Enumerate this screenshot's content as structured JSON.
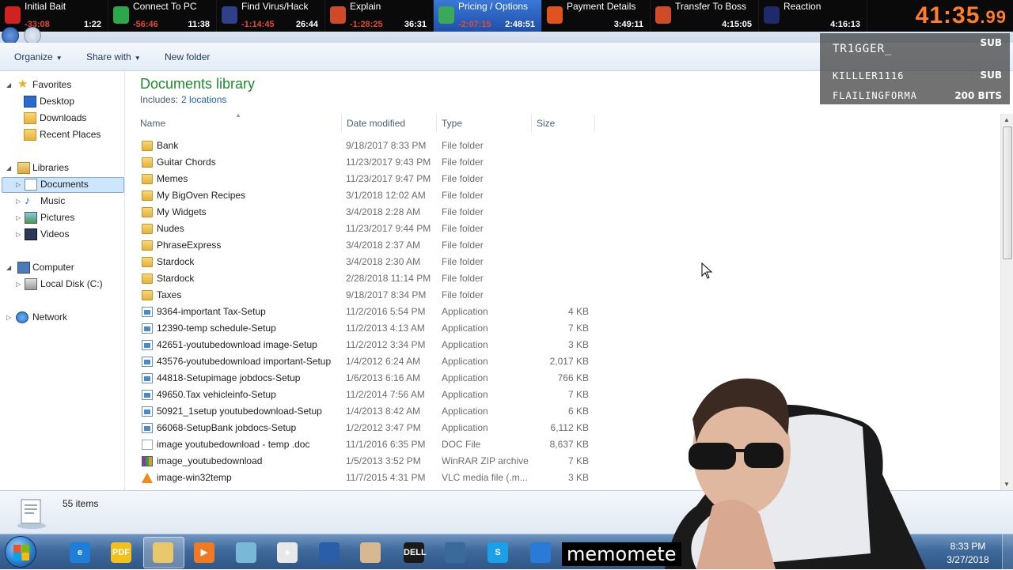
{
  "splits": [
    {
      "name": "Initial Bait",
      "delta": "-33:08",
      "time": "1:22",
      "icon_color": "#d02222",
      "active": false
    },
    {
      "name": "Connect To PC",
      "delta": "-56:46",
      "time": "11:38",
      "icon_color": "#2aa84a",
      "active": false
    },
    {
      "name": "Find Virus/Hack",
      "delta": "-1:14:45",
      "time": "26:44",
      "icon_color": "#2f3f8a",
      "active": false
    },
    {
      "name": "Explain",
      "delta": "-1:28:25",
      "time": "36:31",
      "icon_color": "#d04a2a",
      "active": false
    },
    {
      "name": "Pricing / Options",
      "delta": "-2:07:15",
      "time": "2:48:51",
      "icon_color": "#3aaa5a",
      "active": true
    },
    {
      "name": "Payment Details",
      "delta": "",
      "time": "3:49:11",
      "icon_color": "#e0531e",
      "active": false
    },
    {
      "name": "Transfer To Boss",
      "delta": "",
      "time": "4:15:05",
      "icon_color": "#d04a2a",
      "active": false
    },
    {
      "name": "Reaction",
      "delta": "",
      "time": "4:16:13",
      "icon_color": "#1e2a6a",
      "active": false
    }
  ],
  "timer": {
    "main": "41:35",
    "fraction": ".99",
    "color": "#ff7e2b"
  },
  "toolbar": {
    "organize": "Organize",
    "share_with": "Share with",
    "new_folder": "New folder"
  },
  "nav": {
    "favorites": "Favorites",
    "desktop": "Desktop",
    "downloads": "Downloads",
    "recent_places": "Recent Places",
    "libraries": "Libraries",
    "documents": "Documents",
    "music": "Music",
    "pictures": "Pictures",
    "videos": "Videos",
    "computer": "Computer",
    "local_disk": "Local Disk (C:)",
    "network": "Network"
  },
  "library": {
    "title": "Documents library",
    "includes_label": "Includes:",
    "includes_link": "2 locations"
  },
  "columns": {
    "name": "Name",
    "date": "Date modified",
    "type": "Type",
    "size": "Size"
  },
  "files": [
    {
      "icon": "folder",
      "name": "Bank",
      "date": "9/18/2017 8:33 PM",
      "type": "File folder",
      "size": ""
    },
    {
      "icon": "folder",
      "name": "Guitar Chords",
      "date": "11/23/2017 9:43 PM",
      "type": "File folder",
      "size": ""
    },
    {
      "icon": "folder",
      "name": "Memes",
      "date": "11/23/2017 9:47 PM",
      "type": "File folder",
      "size": ""
    },
    {
      "icon": "folder",
      "name": "My BigOven Recipes",
      "date": "3/1/2018 12:02 AM",
      "type": "File folder",
      "size": ""
    },
    {
      "icon": "folder",
      "name": "My Widgets",
      "date": "3/4/2018 2:28 AM",
      "type": "File folder",
      "size": ""
    },
    {
      "icon": "folder",
      "name": "Nudes",
      "date": "11/23/2017 9:44 PM",
      "type": "File folder",
      "size": ""
    },
    {
      "icon": "folder",
      "name": "PhraseExpress",
      "date": "3/4/2018 2:37 AM",
      "type": "File folder",
      "size": ""
    },
    {
      "icon": "folder",
      "name": "Stardock",
      "date": "3/4/2018 2:30 AM",
      "type": "File folder",
      "size": ""
    },
    {
      "icon": "folder",
      "name": "Stardock",
      "date": "2/28/2018 11:14 PM",
      "type": "File folder",
      "size": ""
    },
    {
      "icon": "folder",
      "name": "Taxes",
      "date": "9/18/2017 8:34 PM",
      "type": "File folder",
      "size": ""
    },
    {
      "icon": "app",
      "name": "9364-important Tax-Setup",
      "date": "11/2/2016 5:54 PM",
      "type": "Application",
      "size": "4 KB"
    },
    {
      "icon": "app",
      "name": "12390-temp schedule-Setup",
      "date": "11/2/2013 4:13 AM",
      "type": "Application",
      "size": "7 KB"
    },
    {
      "icon": "app",
      "name": "42651-youtubedownload image-Setup",
      "date": "11/2/2012 3:34 PM",
      "type": "Application",
      "size": "3 KB"
    },
    {
      "icon": "app",
      "name": "43576-youtubedownload important-Setup",
      "date": "1/4/2012 6:24 AM",
      "type": "Application",
      "size": "2,017 KB"
    },
    {
      "icon": "app",
      "name": "44818-Setupimage jobdocs-Setup",
      "date": "1/6/2013 6:16 AM",
      "type": "Application",
      "size": "766 KB"
    },
    {
      "icon": "app",
      "name": "49650.Tax vehicleinfo-Setup",
      "date": "11/2/2014 7:56 AM",
      "type": "Application",
      "size": "7 KB"
    },
    {
      "icon": "app",
      "name": "50921_1setup youtubedownload-Setup",
      "date": "1/4/2013 8:42 AM",
      "type": "Application",
      "size": "6 KB"
    },
    {
      "icon": "app",
      "name": "66068-SetupBank jobdocs-Setup",
      "date": "1/2/2012 3:47 PM",
      "type": "Application",
      "size": "6,112 KB"
    },
    {
      "icon": "doc",
      "name": "image youtubedownload - temp .doc",
      "date": "11/1/2016 6:35 PM",
      "type": "DOC File",
      "size": "8,637 KB"
    },
    {
      "icon": "rar",
      "name": "image_youtubedownload",
      "date": "1/5/2013 3:52 PM",
      "type": "WinRAR ZIP archive",
      "size": "7 KB"
    },
    {
      "icon": "vlc",
      "name": "image-win32temp",
      "date": "11/7/2015 4:31 PM",
      "type": "VLC media file (.m...",
      "size": "3 KB"
    }
  ],
  "details": {
    "count": "55 items"
  },
  "taskbar": {
    "icons": [
      {
        "name": "ie-icon",
        "label": "e",
        "color": "#1e7fd8"
      },
      {
        "name": "pdf-icon",
        "label": "PDF",
        "color": "#f2c21a"
      },
      {
        "name": "explorer-icon",
        "label": "",
        "color": "#e8c86a"
      },
      {
        "name": "media-player-icon",
        "label": "▶",
        "color": "#ef7a22"
      },
      {
        "name": "notepad-icon",
        "label": "",
        "color": "#7ab8d8"
      },
      {
        "name": "solitaire-icon",
        "label": "♠",
        "color": "#e8e8e8"
      },
      {
        "name": "search-doc-icon",
        "label": "",
        "color": "#2a5fa8"
      },
      {
        "name": "paint-icon",
        "label": "",
        "color": "#d8b890"
      },
      {
        "name": "dell-icon",
        "label": "DELL",
        "color": "#1a1a1a"
      },
      {
        "name": "remote-support-icon",
        "label": "",
        "color": "#3a6a9a"
      },
      {
        "name": "skype-icon",
        "label": "S",
        "color": "#1a9fe8"
      },
      {
        "name": "browser-icon",
        "label": "",
        "color": "#2a7ad8"
      }
    ],
    "clock_time": "8:33 PM",
    "clock_date": "3/27/2018"
  },
  "alerts": [
    {
      "who": "TR1GGER_",
      "what": "SUB"
    },
    {
      "who": "KILLLER1116",
      "what": "SUB"
    },
    {
      "who": "FLAILINGFORMA",
      "what": "200 BITS"
    }
  ],
  "watermark": "memomete"
}
